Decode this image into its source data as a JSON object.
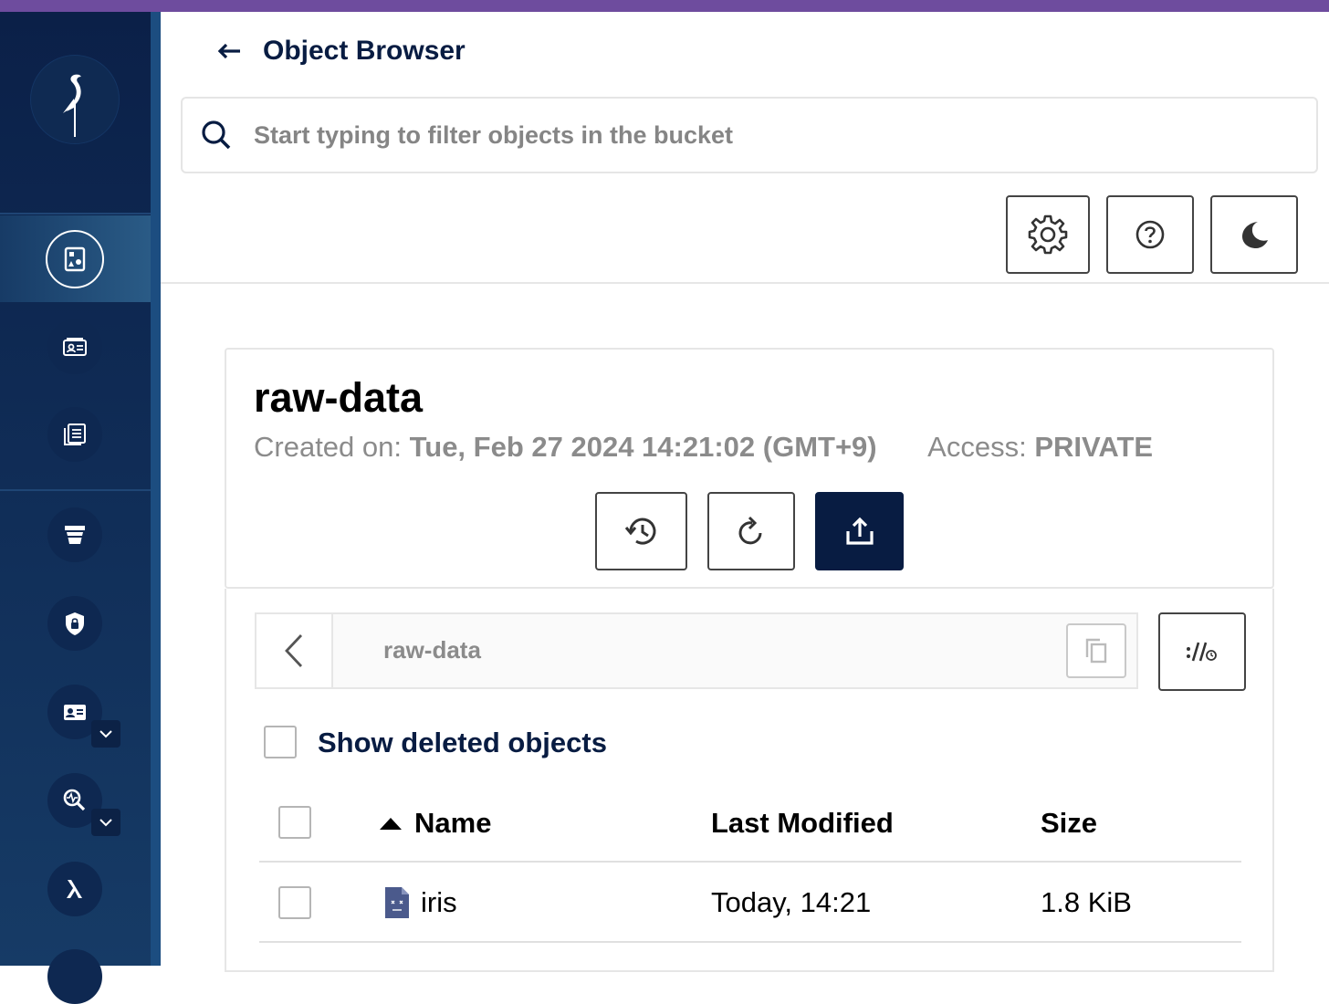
{
  "app": {
    "accent_color": "#6e4c9e",
    "sidebar_color": "#0b2048",
    "primary_button_color": "#081c42"
  },
  "header": {
    "title": "Object Browser",
    "back_icon": "arrow-left-icon"
  },
  "search": {
    "placeholder": "Start typing to filter objects in the bucket",
    "value": ""
  },
  "toolbar": {
    "buttons": [
      {
        "icon": "gear-icon"
      },
      {
        "icon": "help-circle-icon"
      },
      {
        "icon": "moon-icon"
      }
    ]
  },
  "sidebar": {
    "logo_icon": "minio-bird-logo-icon",
    "items": [
      {
        "icon": "object-browser-icon",
        "active": true
      },
      {
        "icon": "access-keys-icon",
        "active": false
      },
      {
        "icon": "documentation-icon",
        "active": false
      },
      {
        "icon": "buckets-icon",
        "active": false
      },
      {
        "icon": "policies-icon",
        "active": false
      },
      {
        "icon": "identity-icon",
        "active": false,
        "expandable": true
      },
      {
        "icon": "monitoring-icon",
        "active": false,
        "expandable": true
      },
      {
        "icon": "lambda-icon",
        "active": false
      }
    ]
  },
  "bucket": {
    "name": "raw-data",
    "created_label": "Created on:",
    "created_value": "Tue, Feb 27 2024 14:21:02 (GMT+9)",
    "access_label": "Access:",
    "access_value": "PRIVATE",
    "actions": [
      {
        "icon": "history-icon"
      },
      {
        "icon": "refresh-icon"
      },
      {
        "icon": "upload-icon"
      }
    ]
  },
  "path": {
    "current": "raw-data",
    "copy_icon": "copy-icon",
    "rewind_icon": "rewind-icon"
  },
  "show_deleted": {
    "label": "Show deleted objects",
    "checked": false
  },
  "table": {
    "columns": [
      "Name",
      "Last Modified",
      "Size"
    ],
    "sort_column": "Name",
    "sort_direction": "ascending",
    "rows": [
      {
        "name": "iris",
        "last_modified": "Today, 14:21",
        "size": "1.8 KiB",
        "icon": "file-icon"
      }
    ]
  }
}
